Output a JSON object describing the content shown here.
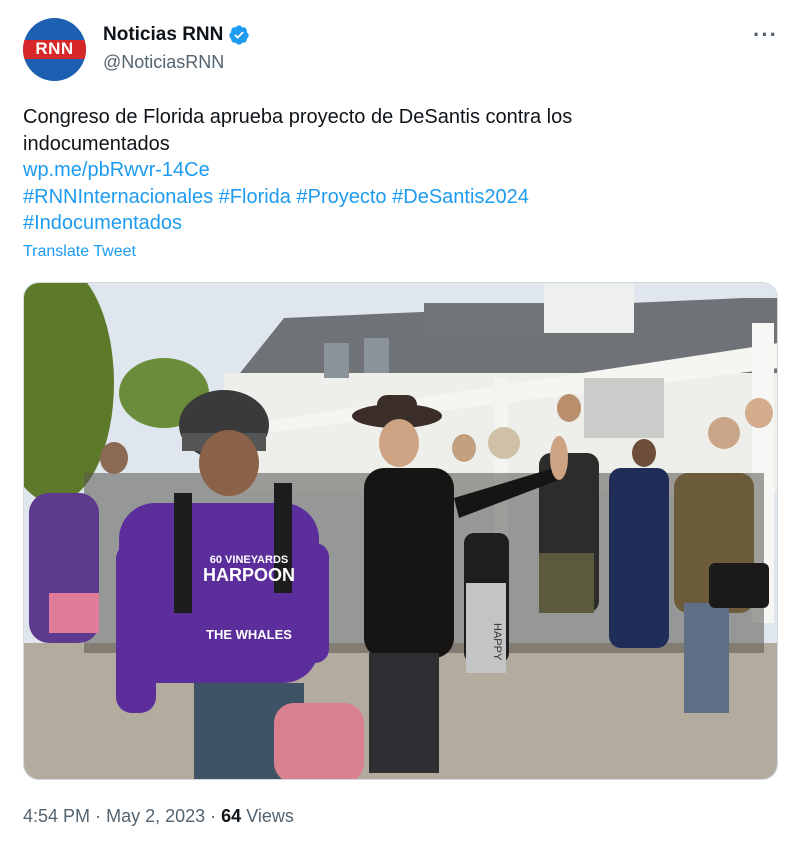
{
  "account": {
    "avatar_logo": "RNN",
    "display_name": "Noticias RNN",
    "handle": "@NoticiasRNN",
    "verified_color": "#1d9bf0"
  },
  "menu": {
    "more_label": "···"
  },
  "tweet": {
    "text_line1": "Congreso de Florida aprueba proyecto de DeSantis contra los",
    "text_line2": "indocumentados",
    "link": "wp.me/pbRwvr-14Ce",
    "hashtags": [
      "#RNNInternacionales",
      "#Florida",
      "#Proyecto",
      "#DeSantis2024",
      "#Indocumentados"
    ],
    "translate_label": "Translate Tweet"
  },
  "media": {
    "description_icon": "photo",
    "shirt_text": [
      "60 VINEYARDS",
      "HARPOON",
      "THE WHALES"
    ],
    "pants_text": "HAPPY"
  },
  "footer": {
    "time": "4:54 PM",
    "date": "May 2, 2023",
    "views_count": "64",
    "views_label": "Views"
  },
  "colors": {
    "link": "#1d9bf0",
    "secondary": "#536471",
    "brand_red": "#d62828",
    "brand_blue": "#1d5fb0"
  }
}
